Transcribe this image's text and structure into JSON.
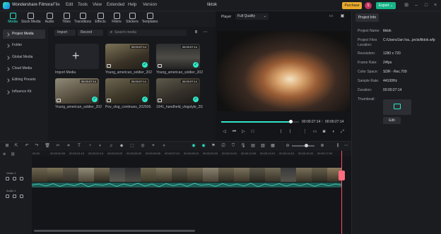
{
  "app": {
    "name": "Wondershare Filmora",
    "project_title": "tiktok",
    "menu": [
      "File",
      "Edit",
      "Tools",
      "View",
      "Extended",
      "Help",
      "Version"
    ],
    "purchase_label": "Purchase",
    "avatar_letter": "S",
    "export_label": "Export ⌄"
  },
  "toolbar": {
    "tabs": [
      {
        "label": "Media",
        "active": true
      },
      {
        "label": "Stock Media"
      },
      {
        "label": "Audio"
      },
      {
        "label": "Titles"
      },
      {
        "label": "Transitions"
      },
      {
        "label": "Effects"
      },
      {
        "label": "Filters"
      },
      {
        "label": "Stickers"
      },
      {
        "label": "Templates"
      }
    ]
  },
  "leftnav": {
    "items": [
      {
        "label": "Project Media",
        "active": true
      },
      {
        "label": "Folder"
      },
      {
        "label": "Global Media"
      },
      {
        "label": "Cloud Media"
      },
      {
        "label": "Editing Presets"
      },
      {
        "label": "Influence Kit"
      }
    ]
  },
  "media": {
    "import_chip": "Import",
    "record_chip": "Record",
    "search_placeholder": "Search media",
    "import_label": "Import Media",
    "clips": [
      {
        "name": "Young_american_soldier_202...",
        "duration": "00:00:07:14"
      },
      {
        "name": "Young_american_soldier_202...",
        "duration": "00:00:07:14"
      },
      {
        "name": "Young_american_soldier_202...",
        "duration": "00:00:07:14"
      },
      {
        "name": "Pov_vlog_continues_202506...",
        "duration": "00:00:07:14"
      },
      {
        "name": "1941_handheld_vlogstyle_2025...",
        "duration": "00:00:07:14"
      }
    ]
  },
  "player": {
    "tab": "Player",
    "quality": "Full Quality",
    "current_time": "00:00:27:14",
    "total_time": "00:00:27:14",
    "progress": 0.89
  },
  "info": {
    "tab": "Project Info",
    "rows": [
      {
        "k": "Project Name:",
        "v": "tiktok"
      },
      {
        "k": "Project Files Location:",
        "v": "C:/Users/Jan Iva...jects/tiktok.wfp"
      },
      {
        "k": "Resolution:",
        "v": "1280 x 720"
      },
      {
        "k": "Frame Rate:",
        "v": "24fps"
      },
      {
        "k": "Color Space:",
        "v": "SDR - Rec.709"
      },
      {
        "k": "Sample Rate:",
        "v": "44100Hz"
      },
      {
        "k": "Duration:",
        "v": "00:00:27:14"
      },
      {
        "k": "Thumbnail:",
        "v": ""
      }
    ],
    "edit_label": "Edit"
  },
  "timeline": {
    "ruler": [
      "00:00",
      "00:00:00:05",
      "00:00:01:10",
      "00:00:02:15",
      "00:00:03:20",
      "00:00:05:00",
      "00:00:06:05",
      "00:00:07:10",
      "00:00:08:15",
      "00:00:09:20",
      "00:00:11:00",
      "00:00:12:05",
      "00:00:13:10",
      "00:00:14:15",
      "00:00:15:20",
      "00:00:17:00",
      "00:00:18:05",
      "00:00:19:10"
    ],
    "video_track": "Video 1",
    "audio_track": "Audio 1"
  }
}
